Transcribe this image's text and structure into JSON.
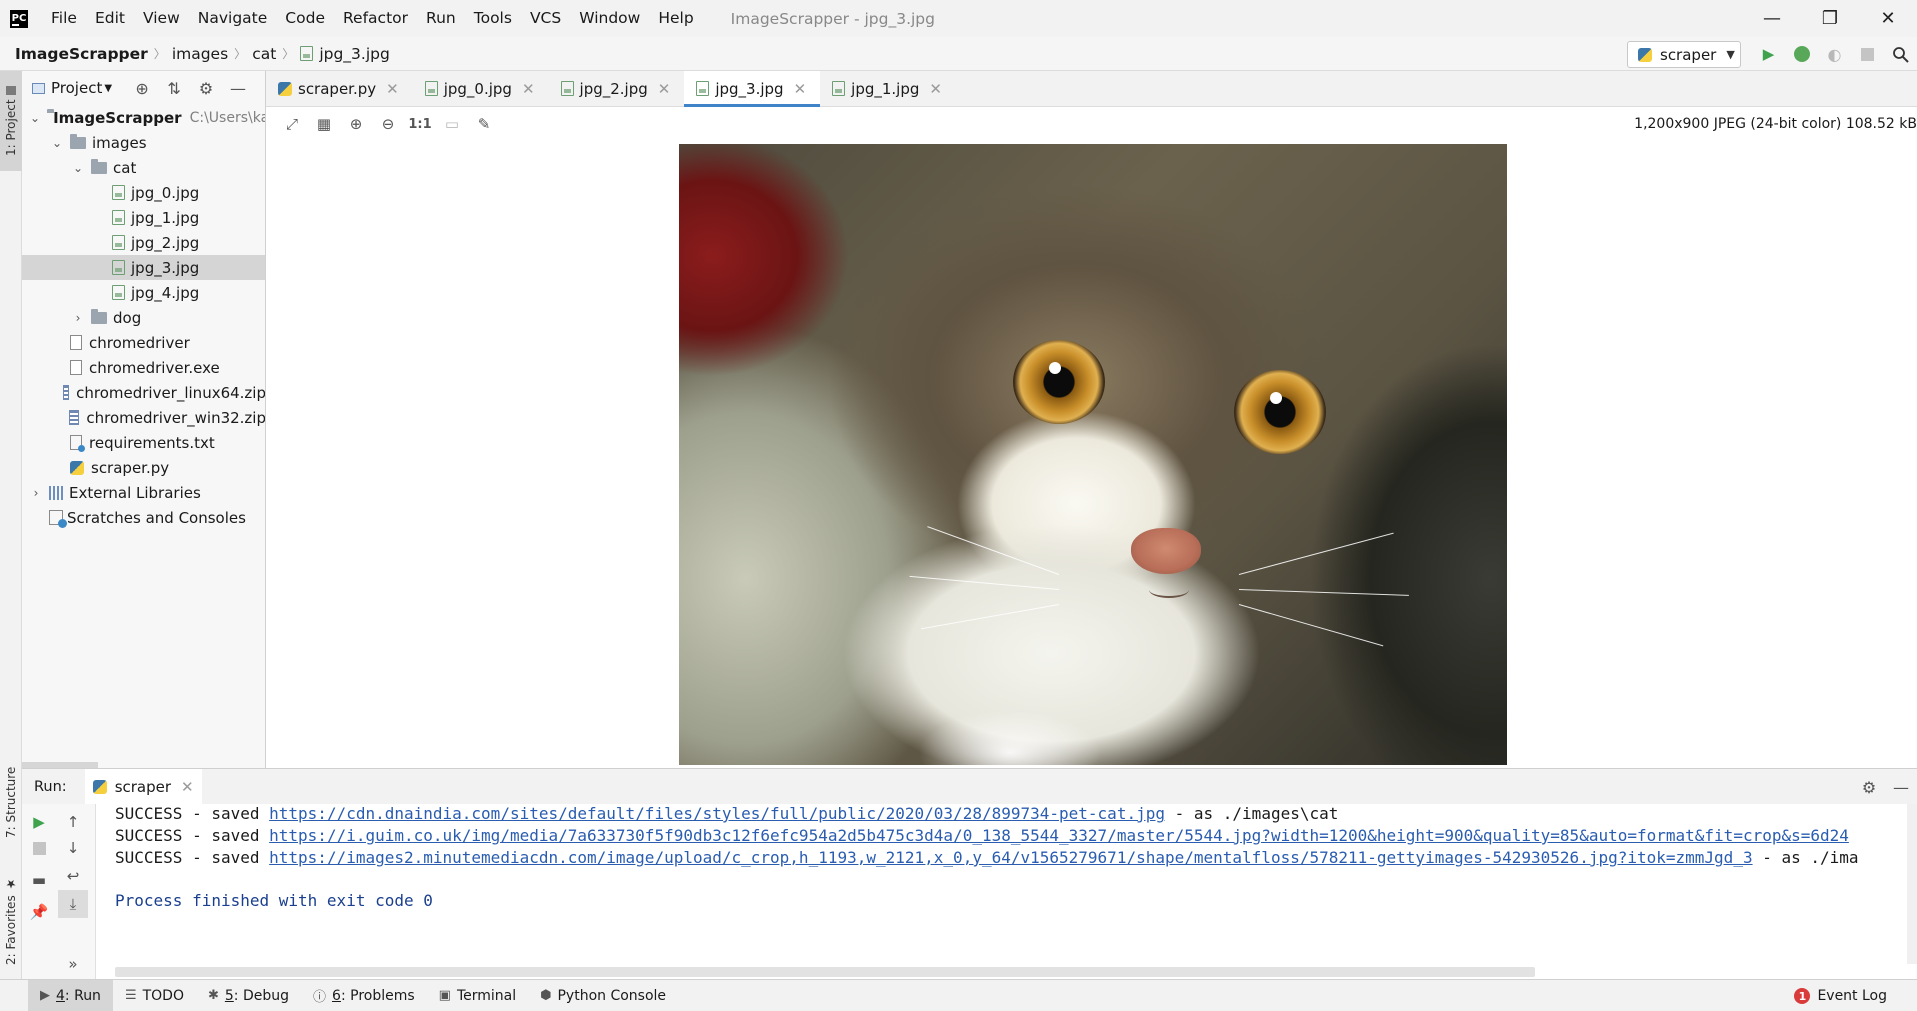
{
  "menu": {
    "items": [
      "File",
      "Edit",
      "View",
      "Navigate",
      "Code",
      "Refactor",
      "Run",
      "Tools",
      "VCS",
      "Window",
      "Help"
    ],
    "window_title": "ImageScrapper - jpg_3.jpg"
  },
  "window_controls": {
    "minimize": "—",
    "restore": "❐",
    "close": "✕"
  },
  "breadcrumb": [
    "ImageScrapper",
    "images",
    "cat",
    "jpg_3.jpg"
  ],
  "run_config": {
    "name": "scraper"
  },
  "left_stripe": {
    "project": "1: Project",
    "structure": "7: Structure",
    "favorites": "2: Favorites"
  },
  "project_panel": {
    "title": "Project",
    "tree": [
      {
        "label": "ImageScrapper",
        "hint": "C:\\Users\\ka",
        "level": 0,
        "kind": "module",
        "arrow": "open"
      },
      {
        "label": "images",
        "level": 1,
        "kind": "folder",
        "arrow": "open"
      },
      {
        "label": "cat",
        "level": 2,
        "kind": "folder",
        "arrow": "open"
      },
      {
        "label": "jpg_0.jpg",
        "level": 3,
        "kind": "image"
      },
      {
        "label": "jpg_1.jpg",
        "level": 3,
        "kind": "image"
      },
      {
        "label": "jpg_2.jpg",
        "level": 3,
        "kind": "image"
      },
      {
        "label": "jpg_3.jpg",
        "level": 3,
        "kind": "image",
        "selected": true
      },
      {
        "label": "jpg_4.jpg",
        "level": 3,
        "kind": "image"
      },
      {
        "label": "dog",
        "level": 2,
        "kind": "folder",
        "arrow": "closed"
      },
      {
        "label": "chromedriver",
        "level": 1,
        "kind": "text"
      },
      {
        "label": "chromedriver.exe",
        "level": 1,
        "kind": "text"
      },
      {
        "label": "chromedriver_linux64.zip",
        "level": 1,
        "kind": "zip"
      },
      {
        "label": "chromedriver_win32.zip",
        "level": 1,
        "kind": "zip"
      },
      {
        "label": "requirements.txt",
        "level": 1,
        "kind": "config"
      },
      {
        "label": "scraper.py",
        "level": 1,
        "kind": "python"
      },
      {
        "label": "External Libraries",
        "level": 0,
        "kind": "library",
        "arrow": "closed"
      },
      {
        "label": "Scratches and Consoles",
        "level": 0,
        "kind": "scratch"
      }
    ]
  },
  "editor_tabs": [
    {
      "label": "scraper.py",
      "kind": "python",
      "active": false
    },
    {
      "label": "jpg_0.jpg",
      "kind": "image",
      "active": false
    },
    {
      "label": "jpg_2.jpg",
      "kind": "image",
      "active": false
    },
    {
      "label": "jpg_3.jpg",
      "kind": "image",
      "active": true
    },
    {
      "label": "jpg_1.jpg",
      "kind": "image",
      "active": false
    }
  ],
  "image_toolbar": {
    "actual_size_label": "1:1",
    "info": "1,200x900 JPEG (24-bit color) 108.52 kB"
  },
  "run_panel": {
    "label": "Run:",
    "tab": "scraper",
    "lines": [
      {
        "prefix": "SUCCESS - saved ",
        "url": "https://cdn.dnaindia.com/sites/default/files/styles/full/public/2020/03/28/899734-pet-cat.jpg",
        "suffix": " - as ./images\\cat"
      },
      {
        "prefix": "SUCCESS - saved ",
        "url": "https://i.guim.co.uk/img/media/7a633730f5f90db3c12f6efc954a2d5b475c3d4a/0_138_5544_3327/master/5544.jpg?width=1200&height=900&quality=85&auto=format&fit=crop&s=6d24",
        "suffix": ""
      },
      {
        "prefix": "SUCCESS - saved ",
        "url": "https://images2.minutemediacdn.com/image/upload/c_crop,h_1193,w_2121,x_0,y_64/v1565279671/shape/mentalfloss/578211-gettyimages-542930526.jpg?itok=zmmJgd_3",
        "suffix": " - as ./ima"
      }
    ],
    "exit_message": "Process finished with exit code 0"
  },
  "bottom_bar": {
    "tabs": [
      {
        "num": "4",
        "label": ": Run",
        "icon": "play-icon",
        "active": true
      },
      {
        "num": "",
        "label": "TODO",
        "icon": "list-icon",
        "active": false
      },
      {
        "num": "5",
        "label": ": Debug",
        "icon": "bug-icon",
        "active": false
      },
      {
        "num": "6",
        "label": ": Problems",
        "icon": "info-icon",
        "active": false
      },
      {
        "num": "",
        "label": "Terminal",
        "icon": "terminal-icon",
        "active": false
      },
      {
        "num": "",
        "label": "Python Console",
        "icon": "python-icon",
        "active": false
      }
    ],
    "event_log": "Event Log",
    "event_count": "1"
  },
  "colors": {
    "accent": "#4083c9",
    "link": "#2a5db0",
    "run_green": "#3fa34d",
    "error_red": "#d93a3a"
  }
}
